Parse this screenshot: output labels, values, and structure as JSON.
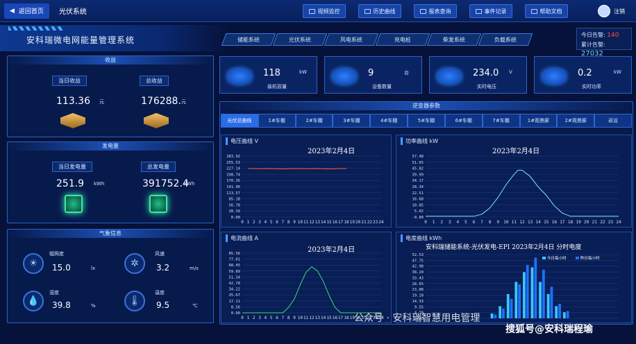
{
  "header": {
    "back_label": "返回首页",
    "app_title": "光伏系统",
    "buttons": [
      {
        "id": "video",
        "label": "视频监控"
      },
      {
        "id": "history",
        "label": "历史曲线"
      },
      {
        "id": "report",
        "label": "报表查询"
      },
      {
        "id": "events",
        "label": "事件记录"
      },
      {
        "id": "help",
        "label": "帮助文档"
      }
    ],
    "logout": "注销"
  },
  "system_name": "安科瑞微电网能量管理系统",
  "nav_tabs": [
    "储能系统",
    "光伏系统",
    "风电系统",
    "充电桩",
    "柴发系统",
    "负载系统"
  ],
  "alarms": {
    "today_label": "今日告警:",
    "today_value": "140",
    "total_label": "累计告警:",
    "total_value": "27032"
  },
  "income": {
    "title": "收益",
    "today_label": "当日收益",
    "today_value": "113.36",
    "today_unit": "元",
    "total_label": "总收益",
    "total_value": "176288.",
    "total_unit": "元"
  },
  "generation": {
    "title": "发电量",
    "today_label": "当日发电量",
    "today_value": "251.9",
    "today_unit": "kWh",
    "total_label": "总发电量",
    "total_value": "391752.4",
    "total_unit": "kWh"
  },
  "weather": {
    "title": "气象信息",
    "items": [
      {
        "name": "辐照度",
        "value": "15.0",
        "unit": "lx",
        "icon": "sun-icon"
      },
      {
        "name": "风速",
        "value": "3.2",
        "unit": "m/s",
        "icon": "fan-icon"
      },
      {
        "name": "湿度",
        "value": "39.8",
        "unit": "%",
        "icon": "droplet-icon"
      },
      {
        "name": "温度",
        "value": "9.5",
        "unit": "℃",
        "icon": "thermometer-icon"
      }
    ]
  },
  "stats": [
    {
      "value": "118",
      "unit": "kW",
      "caption": "装机容量"
    },
    {
      "value": "9",
      "unit": "台",
      "caption": "设备数量"
    },
    {
      "value": "234.0",
      "unit": "V",
      "caption": "实时电压"
    },
    {
      "value": "0.2",
      "unit": "kW",
      "caption": "实时功率"
    }
  ],
  "inverter": {
    "title": "逆变器参数",
    "tabs": [
      "光伏总曲线",
      "1#车棚",
      "2#车棚",
      "3#车棚",
      "4#车棚",
      "5#车棚",
      "6#车棚",
      "7#车棚",
      "1#观景廊",
      "2#观景廊",
      "返设"
    ],
    "active": 0
  },
  "charts": {
    "voltage": {
      "title": "电压曲线",
      "unit": "V",
      "date": "2023年2月4日",
      "yticks": [
        "283.92",
        "255.53",
        "227.14",
        "198.74",
        "170.35",
        "141.96",
        "113.57",
        "85.18",
        "56.78",
        "28.39",
        "0.00"
      ],
      "xticks": [
        "0",
        "1",
        "2",
        "3",
        "4",
        "5",
        "6",
        "7",
        "8",
        "9",
        "10",
        "11",
        "12",
        "13",
        "14",
        "15",
        "16",
        "17",
        "18",
        "19",
        "20",
        "21",
        "22",
        "23",
        "24"
      ]
    },
    "power": {
      "title": "功率曲线",
      "unit": "kW",
      "date": "2023年2月4日",
      "yticks": [
        "57.48",
        "51.65",
        "45.82",
        "39.99",
        "34.17",
        "28.34",
        "22.51",
        "16.68",
        "10.85",
        "5.02",
        "-0.80"
      ],
      "xticks": [
        "0",
        "1",
        "2",
        "3",
        "4",
        "5",
        "6",
        "7",
        "8",
        "9",
        "10",
        "11",
        "12",
        "13",
        "14",
        "15",
        "16",
        "17",
        "18",
        "19",
        "20",
        "21",
        "22",
        "23",
        "24"
      ]
    },
    "current": {
      "title": "电流曲线",
      "unit": "A",
      "date": "2023年2月4日",
      "yticks": [
        "85.56",
        "77.01",
        "68.45",
        "59.89",
        "51.34",
        "42.78",
        "34.22",
        "25.67",
        "17.11",
        "8.56",
        "0.00"
      ],
      "xticks": [
        "0",
        "1",
        "2",
        "3",
        "4",
        "5",
        "6",
        "7",
        "8",
        "9",
        "10",
        "11",
        "12",
        "13",
        "14",
        "15",
        "16",
        "17",
        "18",
        "19",
        "20",
        "21",
        "22",
        "23",
        "24"
      ]
    },
    "energy": {
      "title": "电度曲线",
      "unit": "kWh",
      "heading": "安科瑞储能系统-光伏发电-EPI 2023年2月4日 分时电度",
      "legend": [
        "今日每小时",
        "昨日每小时"
      ],
      "yticks": [
        "52.53",
        "47.75",
        "42.98",
        "38.20",
        "33.43",
        "28.65",
        "23.88",
        "19.10",
        "14.33",
        "9.55",
        "4.78",
        "0.00"
      ]
    }
  },
  "chart_data": [
    {
      "type": "line",
      "title": "电压曲线",
      "ylabel": "V",
      "x": [
        1,
        3,
        5,
        7,
        9,
        11,
        13,
        15,
        17,
        18
      ],
      "values": [
        226,
        225,
        226,
        224,
        226,
        225,
        226,
        224,
        226,
        226
      ],
      "ylim": [
        0,
        283.92
      ]
    },
    {
      "type": "line",
      "title": "功率曲线",
      "ylabel": "kW",
      "x": [
        0,
        6,
        7,
        8,
        9,
        10,
        11,
        11.5,
        12,
        13,
        14,
        15,
        16,
        17,
        18,
        24
      ],
      "values": [
        0,
        0,
        2,
        8,
        18,
        30,
        40,
        44,
        44,
        38,
        28,
        20,
        10,
        3,
        0,
        0
      ],
      "ylim": [
        -0.8,
        57.48
      ]
    },
    {
      "type": "line",
      "title": "电流曲线",
      "ylabel": "A",
      "x": [
        0,
        7,
        8,
        9,
        10,
        11,
        12,
        13,
        14,
        15,
        16,
        17,
        24
      ],
      "values": [
        0,
        0,
        8,
        20,
        40,
        58,
        66,
        60,
        45,
        25,
        8,
        0,
        0
      ],
      "ylim": [
        0,
        85.56
      ]
    },
    {
      "type": "bar",
      "title": "分时电度",
      "series": [
        {
          "name": "今日每小时",
          "values": [
            0,
            0,
            0,
            0,
            0,
            0,
            0,
            0,
            4,
            10,
            20,
            30,
            38,
            42,
            30,
            20,
            10,
            5,
            0,
            0,
            0,
            0,
            0,
            0
          ]
        },
        {
          "name": "昨日每小时",
          "values": [
            0,
            0,
            0,
            0,
            0,
            0,
            0,
            0,
            3,
            8,
            16,
            28,
            44,
            50,
            40,
            26,
            12,
            6,
            0,
            0,
            0,
            0,
            0,
            0
          ]
        }
      ],
      "ylim": [
        0,
        52.53
      ]
    }
  ],
  "watermark": {
    "wechat": "公众号 · 安科瑞智慧用电管理",
    "sohu": "搜狐号@安科瑞程瑜"
  }
}
